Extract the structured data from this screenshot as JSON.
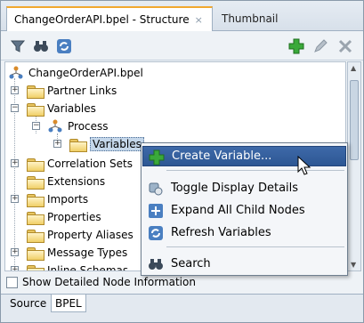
{
  "tabs": {
    "active_label": "ChangeOrderAPI.bpel - Structure",
    "close_glyph": "×",
    "inactive_label": "Thumbnail"
  },
  "toolbar": {
    "left_icons": [
      "filter-icon",
      "binoculars-icon",
      "refresh-icon"
    ],
    "right_icons": [
      "add-icon",
      "edit-pencil-icon",
      "delete-icon"
    ]
  },
  "tree": {
    "root": "ChangeOrderAPI.bpel",
    "items": [
      {
        "label": "Partner Links"
      },
      {
        "label": "Variables"
      },
      {
        "label": "Process"
      },
      {
        "label": "Variables"
      },
      {
        "label": "Correlation Sets"
      },
      {
        "label": "Extensions"
      },
      {
        "label": "Imports"
      },
      {
        "label": "Properties"
      },
      {
        "label": "Property Aliases"
      },
      {
        "label": "Message Types"
      },
      {
        "label": "Inline Schemas"
      }
    ]
  },
  "context_menu": {
    "items": [
      {
        "label": "Create Variable...",
        "icon": "add-icon"
      },
      {
        "label": "Toggle Display Details",
        "icon": "toggle-details-icon"
      },
      {
        "label": "Expand All Child Nodes",
        "icon": "expand-all-icon"
      },
      {
        "label": "Refresh Variables",
        "icon": "refresh-icon"
      },
      {
        "label": "Search",
        "icon": "binoculars-icon"
      }
    ]
  },
  "options": {
    "show_detailed_label": "Show Detailed Node Information",
    "show_detailed_checked": false
  },
  "bottom_tabs": [
    "Source",
    "BPEL"
  ],
  "colors": {
    "active_tab_accent": "#f0a830",
    "menu_highlight": "#2d5794",
    "selection_bg": "#c5d7ea"
  }
}
